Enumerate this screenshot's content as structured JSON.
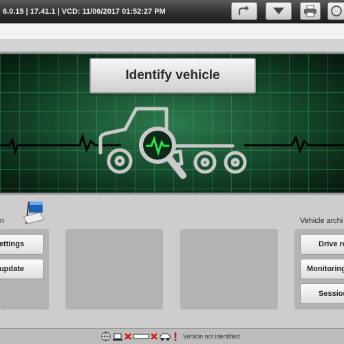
{
  "header": {
    "version_text": "6.0.15 | 17.41.1 | VCD: 11/06/2017 01:52:27 PM",
    "buttons": [
      {
        "icon": "redo-arrow-icon"
      },
      {
        "icon": "dropdown-triangle-icon"
      },
      {
        "icon": "printer-icon"
      },
      {
        "icon": "help-icon"
      }
    ]
  },
  "hero": {
    "identify_label": "Identify vehicle",
    "icon": "vehicle-search-icon",
    "colors": {
      "grid": "#3cbe6e",
      "trace": "#050505",
      "pulse": "#2ee04a"
    }
  },
  "left_section": {
    "label": "n",
    "icon": "flag-icon",
    "buttons": [
      "settings",
      "update"
    ]
  },
  "right_section": {
    "label": "Vehicle archi",
    "buttons": [
      "Drive re",
      "Monitoring",
      "Session"
    ]
  },
  "status": {
    "text": "Vehicle not identified",
    "icons": [
      "globe-icon",
      "laptop-icon",
      "error-x-icon",
      "cable-icon",
      "error-x-icon",
      "car-connect-icon",
      "warning-icon"
    ]
  }
}
